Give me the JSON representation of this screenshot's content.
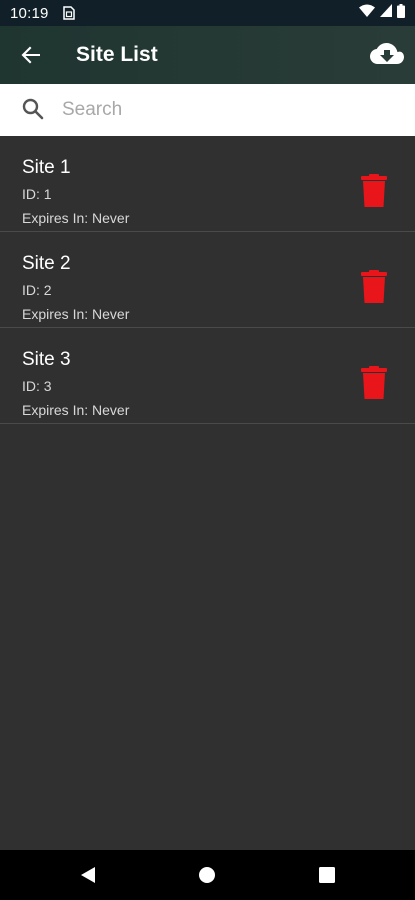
{
  "status_bar": {
    "time": "10:19"
  },
  "app_bar": {
    "title": "Site List",
    "back_icon": "arrow-back-icon",
    "action_icon": "cloud-download-icon"
  },
  "search": {
    "placeholder": "Search",
    "value": ""
  },
  "sites": [
    {
      "name": "Site 1",
      "id": "ID: 1",
      "expires": "Expires In: Never"
    },
    {
      "name": "Site 2",
      "id": "ID: 2",
      "expires": "Expires In: Never"
    },
    {
      "name": "Site 3",
      "id": "ID: 3",
      "expires": "Expires In: Never"
    }
  ],
  "colors": {
    "delete": "#e8151b",
    "background": "#303030",
    "app_bar": "#22352f"
  }
}
